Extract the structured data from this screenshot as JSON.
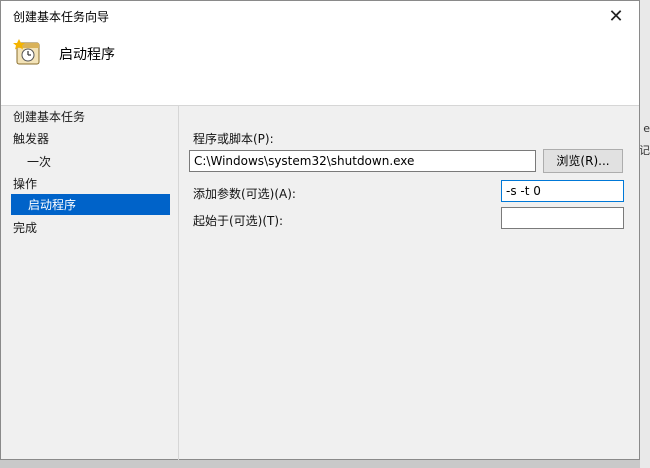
{
  "window": {
    "title": "创建基本任务向导",
    "close_glyph": "✕"
  },
  "header": {
    "title": "启动程序",
    "icon": "task-clock-icon"
  },
  "nav": {
    "heading": "创建基本任务",
    "items": [
      {
        "label": "触发器",
        "level": 0,
        "active": false
      },
      {
        "label": "一次",
        "level": 1,
        "active": false
      },
      {
        "label": "操作",
        "level": 0,
        "active": false
      },
      {
        "label": "启动程序",
        "level": 1,
        "active": true
      },
      {
        "label": "完成",
        "level": 0,
        "active": false
      }
    ]
  },
  "form": {
    "program_label": "程序或脚本(P):",
    "program_value": "C:\\Windows\\system32\\shutdown.exe",
    "browse_label": "浏览(R)...",
    "args_label": "添加参数(可选)(A):",
    "args_value": "-s -t 0",
    "startin_label": "起始于(可选)(T):",
    "startin_value": ""
  },
  "background": {
    "glyph_1": "e",
    "glyph_2": "记"
  },
  "colors": {
    "selection": "#0063c9",
    "focus_border": "#0078d7"
  }
}
